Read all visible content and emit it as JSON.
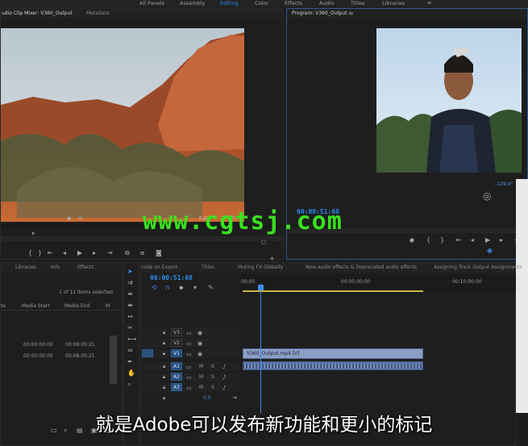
{
  "workspaces": [
    {
      "label": "All Panels",
      "active": false
    },
    {
      "label": "Assembly",
      "active": false
    },
    {
      "label": "Editing",
      "active": true
    },
    {
      "label": "Color",
      "active": false
    },
    {
      "label": "Effects",
      "active": false
    },
    {
      "label": "Audio",
      "active": false
    },
    {
      "label": "Titles",
      "active": false
    },
    {
      "label": "Libraries",
      "active": false
    }
  ],
  "workspaces_more": "»",
  "source_monitor": {
    "tab_clip_mixer": "udio Clip Mixer: V360_Output",
    "tab_metadata": "Metadata",
    "fit_label": "Full"
  },
  "program_monitor": {
    "title": "Program: V360_Output",
    "menu_icon": "≡",
    "timecode": "00:00:51:08",
    "angle": "-129.0°"
  },
  "project_panel": {
    "tabs": [
      "Libraries",
      "Info",
      "Effects"
    ],
    "items_selected": "1 of 11 items selected",
    "columns": [
      "te",
      "Media Start",
      "Media End",
      "M"
    ],
    "rows": [
      {
        "start": "00:00:00:00",
        "end": "00:08:05:21"
      },
      {
        "start": "00:00:00:00",
        "end": "00:08:05:21"
      }
    ]
  },
  "timeline": {
    "tabs": [
      "code on Export",
      "Titles",
      "Muting FX Globally",
      "New audio effects & Deprecated audio effects",
      "Assigning Track Output Assignments"
    ],
    "timecode": "00:00:51:08",
    "ruler": [
      "00:00",
      "00:05:00:00",
      "00:10:00:00"
    ],
    "tracks_video": [
      "V3",
      "V2",
      "V1"
    ],
    "tracks_audio": [
      "A1",
      "A2",
      "A3"
    ],
    "mute": "M",
    "solo": "S",
    "master_value": "0.0",
    "clip_name": "V360_Output.mp4 [V]"
  },
  "watermark": "www.cgtsj.com",
  "subtitle": "就是Adobe可以发布新功能和更小的标记"
}
